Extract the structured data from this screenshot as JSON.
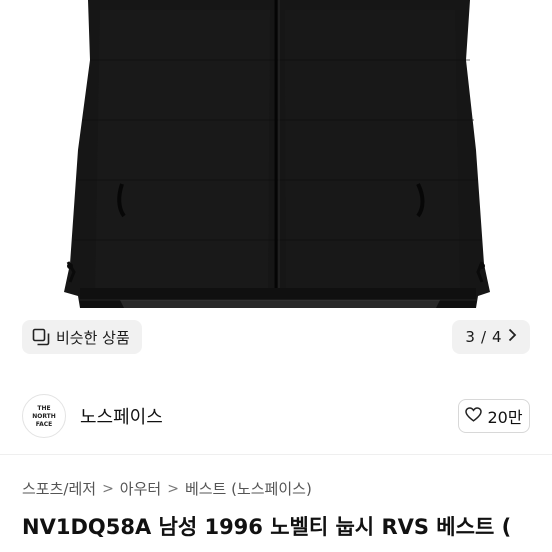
{
  "gallery": {
    "similar_label": "비슷한 상품",
    "similar_icon": "similar-items-icon",
    "page_current": "3",
    "page_sep": "/",
    "page_total": "4",
    "next_icon": "chevron-right-icon",
    "product_color": "#141414"
  },
  "seller": {
    "logo_lines": [
      "THE",
      "NORTH",
      "FACE"
    ],
    "name": "노스페이스",
    "like_icon": "heart-icon",
    "like_count": "20만"
  },
  "breadcrumb": {
    "items": [
      "스포츠/레저",
      "아우터",
      "베스트 (노스페이스)"
    ],
    "separator": ">"
  },
  "product": {
    "title": "NV1DQ58A 남성 1996 노벨티 눕시 RVS 베스트 ("
  }
}
